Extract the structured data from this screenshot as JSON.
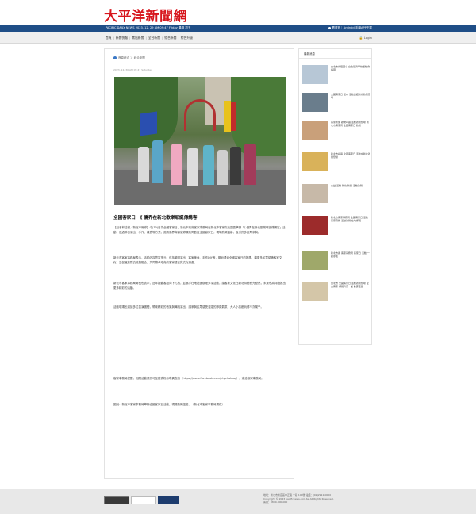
{
  "header": {
    "logo_text": "大平洋新聞網",
    "date_line": "PACIFIC DAILY NEWS 2023, 12, 29 AM 09:47 Friday 農曆 初五",
    "app_label": "看資訊｜Android 手機APP下載"
  },
  "nav": {
    "items": [
      "首頁",
      "新聞快報",
      "焦點新聞",
      "全台新聞",
      "綜合新聞",
      "綜合升級"
    ],
    "login": "Login"
  },
  "article": {
    "breadcrumb": "首頁綜合 ＞ 綜合新聞",
    "meta": "2023, 12, 30 AM 09:47 Saturday",
    "title": "全國客家日　《 僑界在新北歡樂耶誕傳講客",
    "paragraphs": [
      "【記者林佳德／新北市報導】今(30)日為全國客家日，新北市政府客家事務局在新北市客家文化園區舉辦「《 僑界在新北歡樂耶誕傳講客」活動，透過節日演出、手作、義賣等方式，邀請僑界與客家鄉親共同歡度全國客家日，現場熱鬧溫馨，吸引許多民眾參與。",
      "新北市客家事務局表示，活動內容豐富多元，包括樂團演出、客家美食、手作DIY等，期盼透過全國客家日的推廣，讓更多民眾認識客家文化，並促進族群交流與融合，共同傳承珍貴的客家語言與文化資產。",
      "新北市客家事務局局長也表示，近年推動客語向下扎根，並攜手在地社團辦理多項活動，讓客家文化在新北持續發光發熱，未來也將持續推出更多精彩的活動。",
      "活動現場也邀請多位表演團體，帶來精彩的音樂與舞蹈演出，讓參與民眾感受濃濃的節慶氣氛，大人小孩都玩得不亦樂乎。",
      "客家事務局提醒，相關活動資訊可至臉書粉絲專頁查詢（https://www.facebook.com/ntpchakka/），或洽客家事務局。",
      "圖說：新北市客家事務局舉辦全國客家日活動，現場熱鬧溫馨。（新北市客家事務局提供）"
    ]
  },
  "sidebar": {
    "title": "最新消息",
    "items": [
      {
        "text": "台北市光復國小 台北慈濟學校運動會揭幕",
        "color": "#b7c7d6"
      },
      {
        "text": "全國客家日 暖心 活動連結新北熱鬧登場",
        "color": "#6a7d8c"
      },
      {
        "text": "客家新聞 歡樂耶誕 活動熱鬧登場 新北市客家局 全國客家日 熱鬧",
        "color": "#c9a07a"
      },
      {
        "text": "新北市議員 全國客家日 活動在新北熱鬧登場",
        "color": "#d9b25a"
      },
      {
        "text": "公益 活動 新北 新聞 活動熱鬧",
        "color": "#c7b9a8"
      },
      {
        "text": "新北市客家事務局 全國客家日 活動 客家音樂 活動熱鬧 在地鄉親",
        "color": "#9c2b2b"
      },
      {
        "text": "新北市長 客家事務局 客家日 活動 一起參加",
        "color": "#9fa86a"
      },
      {
        "text": "台北市 全國客家日 活動熱鬧登場 全台客家 鄉親齊聚一堂 歡慶佳節",
        "color": "#d4c6a8"
      }
    ]
  },
  "footer": {
    "line1": "地址：新北市新店區中正路 一段 100號 電話：(02)2911-0000",
    "line2": "Copyright © 2023 pacificnews.com.tw All Rights Reserved.",
    "phone": "客服：0800-000-000"
  }
}
